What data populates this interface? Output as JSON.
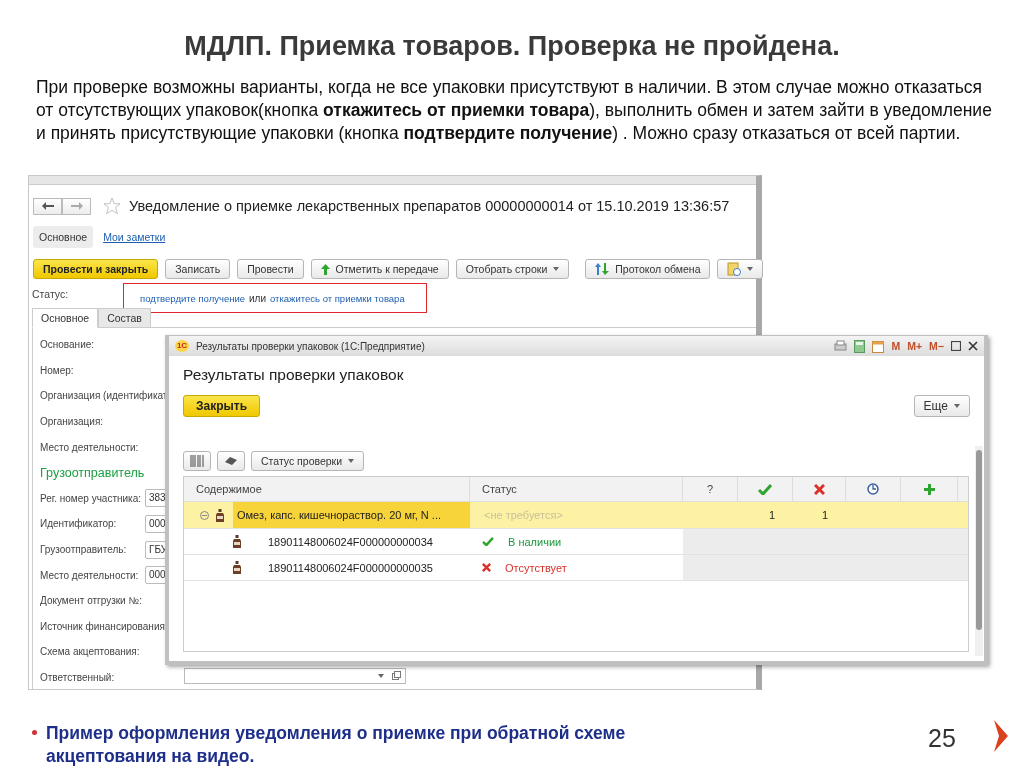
{
  "slide": {
    "title": "МДЛП. Приемка товаров. Проверка не пройдена.",
    "intro": "При проверке возможны варианты, когда не все упаковки присутствуют в наличии. В этом случае можно отказаться от отсутствующих упаковок(кнопка **откажитесь от приемки товара**), выполнить обмен и затем зайти в уведомление и принять присутствующие упаковки (кнопка **подтвердите получение**) . Можно сразу отказаться от всей партии.",
    "bullet": "Пример оформления уведомления о приемке при обратной схеме акцептования на видео.",
    "page_number": "25"
  },
  "document_window": {
    "title": "Уведомление о приемке лекарственных препаратов 00000000014 от 15.10.2019 13:36:57",
    "nav_tabs": [
      {
        "label": "Основное",
        "selected": true
      },
      {
        "label": "Мои заметки",
        "selected": false
      }
    ],
    "toolbar": [
      {
        "kind": "primary",
        "label": "Провести и закрыть"
      },
      {
        "kind": "plain",
        "label": "Записать"
      },
      {
        "kind": "plain",
        "label": "Провести"
      },
      {
        "kind": "arrow",
        "label": "Отметить к передаче"
      },
      {
        "kind": "menu",
        "label": "Отобрать строки"
      },
      {
        "kind": "exchange",
        "label": "Протокол обмена"
      },
      {
        "kind": "report-menu"
      }
    ],
    "status": {
      "label": "Статус:",
      "confirm_link": "подтвердите получение",
      "conjunction": "или",
      "refuse_link": "откажитесь от приемки товара"
    },
    "form_tabs": [
      {
        "label": "Основное",
        "selected": true
      },
      {
        "label": "Состав",
        "selected": false
      }
    ],
    "fields": [
      {
        "kind": "label",
        "label": "Основание:"
      },
      {
        "kind": "label",
        "label": "Номер:"
      },
      {
        "kind": "label",
        "label": "Организация (идентификат"
      },
      {
        "kind": "label",
        "label": "Организация:"
      },
      {
        "kind": "label",
        "label": "Место деятельности:"
      },
      {
        "kind": "section",
        "label": "Грузоотправитель"
      },
      {
        "kind": "input",
        "label": "Рег. номер участника:",
        "value": "383"
      },
      {
        "kind": "input",
        "label": "Идентификатор:",
        "value": "000"
      },
      {
        "kind": "input",
        "label": "Грузоотправитель:",
        "value": "ГБУ"
      },
      {
        "kind": "input",
        "label": "Место деятельности:",
        "value": "000"
      },
      {
        "kind": "label",
        "label": "Документ отгрузки №:"
      },
      {
        "kind": "label",
        "label": "Источник финансирования"
      },
      {
        "kind": "label",
        "label": "Схема акцептования:"
      },
      {
        "kind": "select",
        "label": "Ответственный:"
      }
    ]
  },
  "results_dialog": {
    "logo": "1С",
    "window_title": "Результаты проверки упаковок  (1С:Предприятие)",
    "memory_buttons": [
      "M",
      "M+",
      "M−"
    ],
    "heading": "Результаты проверки упаковок",
    "close_button": "Закрыть",
    "more_button": "Еще",
    "filter_button": "Статус проверки",
    "columns": [
      {
        "kind": "text",
        "label": "Содержимое"
      },
      {
        "kind": "text",
        "label": "Статус"
      },
      {
        "kind": "text",
        "label": "?"
      },
      {
        "kind": "check"
      },
      {
        "kind": "cross"
      },
      {
        "kind": "clock"
      },
      {
        "kind": "plus"
      }
    ],
    "rows": [
      {
        "kind": "group",
        "selected": true,
        "content": "Омез, капс. кишечнораствор. 20 мг, N ...",
        "status": "<не требуется>",
        "present_count": "1",
        "missing_count": "1"
      },
      {
        "kind": "item",
        "selected": false,
        "content": "18901148006024F000000000034",
        "status": "В наличии",
        "in_stock": true
      },
      {
        "kind": "item",
        "selected": false,
        "content": "18901148006024F000000000035",
        "status": "Отсутствует",
        "in_stock": false
      }
    ]
  }
}
